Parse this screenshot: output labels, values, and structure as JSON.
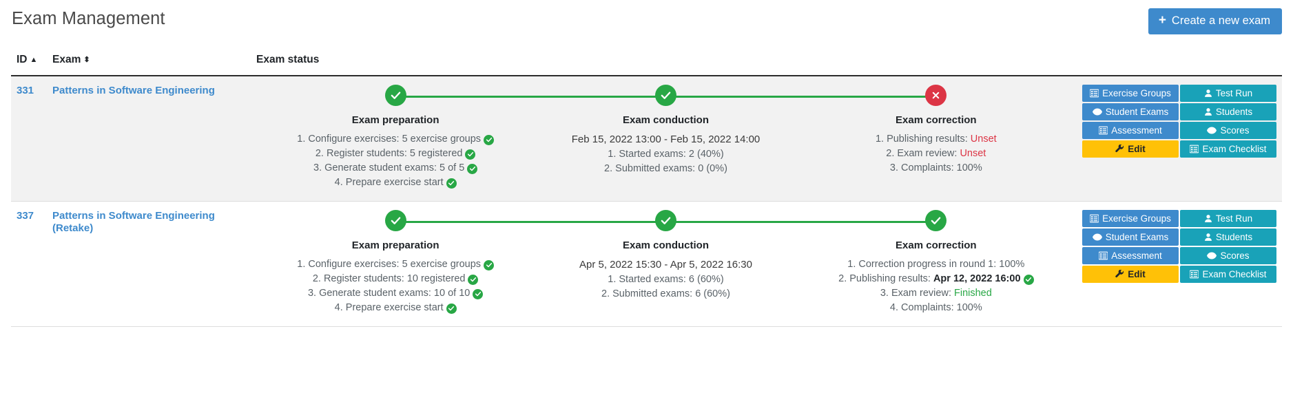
{
  "header": {
    "title": "Exam Management",
    "create_button": {
      "plus": "+",
      "label": "Create a new exam"
    }
  },
  "table": {
    "columns": {
      "id": "ID",
      "exam": "Exam",
      "status": "Exam status"
    },
    "sort": {
      "id_caret": "▲",
      "exam_caret": "⬍"
    }
  },
  "stage_titles": {
    "preparation": "Exam preparation",
    "conduction": "Exam conduction",
    "correction": "Exam correction"
  },
  "actions": {
    "exercise_groups": "Exercise Groups",
    "test_run": "Test Run",
    "student_exams": "Student Exams",
    "students": "Students",
    "assessment": "Assessment",
    "scores": "Scores",
    "edit": "Edit",
    "exam_checklist": "Exam Checklist"
  },
  "icons": {
    "exercise_groups": "list-icon",
    "test_run": "user-icon",
    "student_exams": "eye-icon",
    "students": "user-icon",
    "assessment": "list-icon",
    "scores": "eye-icon",
    "edit": "wrench-icon",
    "exam_checklist": "list-icon"
  },
  "colors": {
    "primary_blue": "#3e8acc",
    "teal": "#19a2b8",
    "yellow": "#ffc107",
    "success_green": "#28a745",
    "danger_red": "#dc3545",
    "link_blue": "#3e8acc"
  },
  "exams": [
    {
      "id": "331",
      "name": "Patterns in Software Engineering",
      "preparation": {
        "status": "ok",
        "lines": [
          "1. Configure exercises: 5 exercise groups",
          "2. Register students: 5 registered",
          "3. Generate student exams: 5 of 5",
          "4. Prepare exercise start"
        ],
        "checks": [
          true,
          true,
          true,
          true
        ]
      },
      "conduction": {
        "status": "ok",
        "date_range": "Feb 15, 2022 13:00 - Feb 15, 2022 14:00",
        "lines": [
          "1. Started exams: 2 (40%)",
          "2. Submitted exams: 0 (0%)"
        ]
      },
      "correction": {
        "status": "fail",
        "lines": [
          {
            "label": "1. Publishing results: ",
            "value": "Unset",
            "value_style": "unset",
            "check": false
          },
          {
            "label": "2. Exam review: ",
            "value": "Unset",
            "value_style": "unset",
            "check": false
          },
          {
            "label": "3. Complaints: 100%",
            "value": "",
            "value_style": "plain",
            "check": false
          }
        ]
      }
    },
    {
      "id": "337",
      "name": "Patterns in Software Engineering (Retake)",
      "preparation": {
        "status": "ok",
        "lines": [
          "1. Configure exercises: 5 exercise groups",
          "2. Register students: 10 registered",
          "3. Generate student exams: 10 of 10",
          "4. Prepare exercise start"
        ],
        "checks": [
          true,
          true,
          true,
          true
        ]
      },
      "conduction": {
        "status": "ok",
        "date_range": "Apr 5, 2022 15:30 - Apr 5, 2022 16:30",
        "lines": [
          "1. Started exams: 6 (60%)",
          "2. Submitted exams: 6 (60%)"
        ]
      },
      "correction": {
        "status": "ok",
        "lines": [
          {
            "label": "1. Correction progress in round 1: 100%",
            "value": "",
            "value_style": "plain",
            "check": false
          },
          {
            "label": "2. Publishing results: ",
            "value": "Apr 12, 2022 16:00",
            "value_style": "strong",
            "check": true
          },
          {
            "label": "3. Exam review: ",
            "value": "Finished",
            "value_style": "finished",
            "check": false
          },
          {
            "label": "4. Complaints: 100%",
            "value": "",
            "value_style": "plain",
            "check": false
          }
        ]
      }
    }
  ]
}
